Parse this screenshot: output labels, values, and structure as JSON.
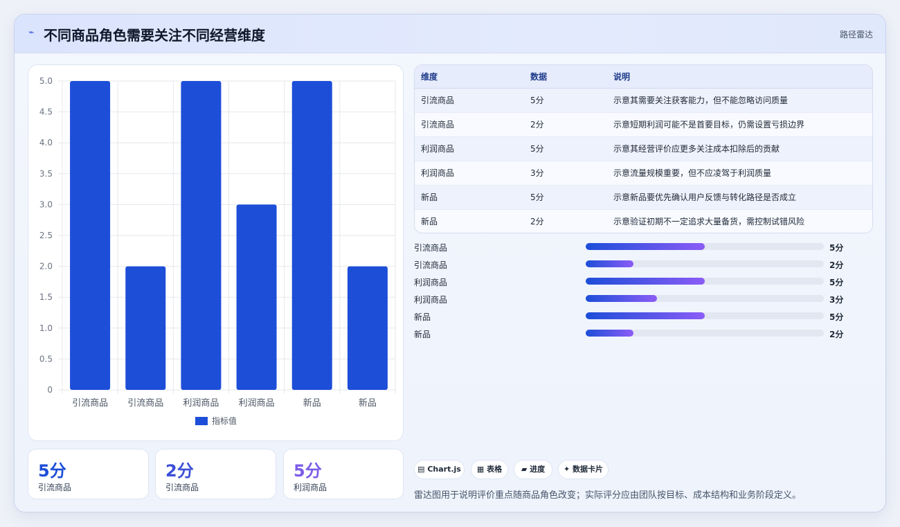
{
  "header": {
    "title": "不同商品角色需要关注不同经营维度",
    "tag": "路径雷达",
    "logo_icon": "sparkle-icon"
  },
  "chart_data": {
    "type": "bar",
    "categories": [
      "引流商品",
      "引流商品",
      "利润商品",
      "利润商品",
      "新品",
      "新品"
    ],
    "series": [
      {
        "name": "指标值",
        "values": [
          5,
          2,
          5,
          3,
          5,
          2
        ],
        "color": "#1d4ed8"
      }
    ],
    "ylim": [
      0,
      5
    ],
    "yticks": [
      "0",
      "0.5",
      "1.0",
      "1.5",
      "2.0",
      "2.5",
      "3.0",
      "3.5",
      "4.0",
      "4.5",
      "5.0"
    ],
    "grid": true,
    "legend": "bottom"
  },
  "kpis": [
    {
      "value": "5分",
      "label": "引流商品",
      "color": "#1d4ed8"
    },
    {
      "value": "2分",
      "label": "引流商品",
      "color": "#3b4fd6"
    },
    {
      "value": "5分",
      "label": "利润商品",
      "color": "#7c5ce8"
    }
  ],
  "table": {
    "headers": [
      "维度",
      "数据",
      "说明"
    ],
    "rows": [
      [
        "引流商品",
        "5分",
        "示意其需要关注获客能力，但不能忽略访问质量"
      ],
      [
        "引流商品",
        "2分",
        "示意短期利润可能不是首要目标，仍需设置亏损边界"
      ],
      [
        "利润商品",
        "5分",
        "示意其经营评价应更多关注成本扣除后的贡献"
      ],
      [
        "利润商品",
        "3分",
        "示意流量规模重要，但不应凌驾于利润质量"
      ],
      [
        "新品",
        "5分",
        "示意新品要优先确认用户反馈与转化路径是否成立"
      ],
      [
        "新品",
        "2分",
        "示意验证初期不一定追求大量备货，需控制试错风险"
      ]
    ]
  },
  "progress": [
    {
      "label": "引流商品",
      "value": 5,
      "max": 10,
      "text": "5分"
    },
    {
      "label": "引流商品",
      "value": 2,
      "max": 10,
      "text": "2分"
    },
    {
      "label": "利润商品",
      "value": 5,
      "max": 10,
      "text": "5分"
    },
    {
      "label": "利润商品",
      "value": 3,
      "max": 10,
      "text": "3分"
    },
    {
      "label": "新品",
      "value": 5,
      "max": 10,
      "text": "5分"
    },
    {
      "label": "新品",
      "value": 2,
      "max": 10,
      "text": "2分"
    }
  ],
  "pills": [
    {
      "icon": "chart-icon",
      "label": "▤ Chart.js"
    },
    {
      "icon": "table-icon",
      "label": "▦ 表格"
    },
    {
      "icon": "progress-icon",
      "label": "▰ 进度"
    },
    {
      "icon": "card-icon",
      "label": "✦ 数据卡片"
    }
  ],
  "footnote": "雷达图用于说明评价重点随商品角色改变；实际评分应由团队按目标、成本结构和业务阶段定义。"
}
